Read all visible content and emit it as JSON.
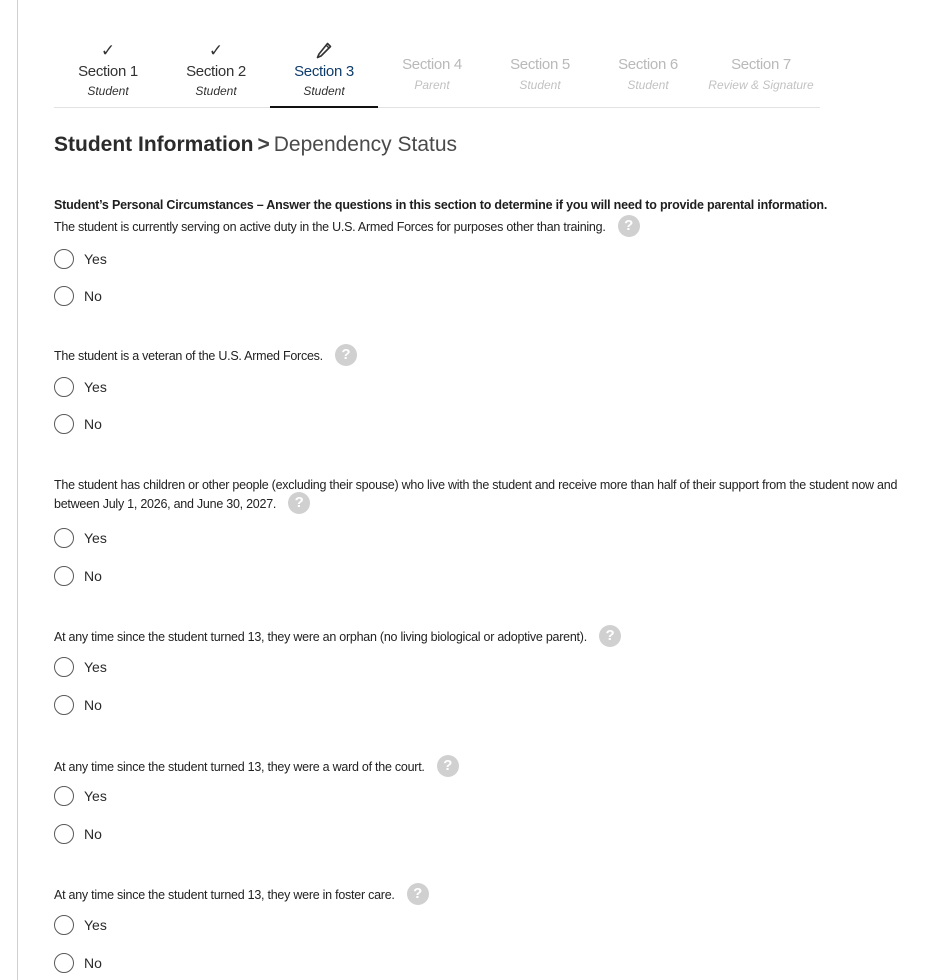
{
  "stepper": [
    {
      "title": "Section 1",
      "subtitle": "Student",
      "status": "complete",
      "icon": "check-icon"
    },
    {
      "title": "Section 2",
      "subtitle": "Student",
      "status": "complete",
      "icon": "check-icon"
    },
    {
      "title": "Section 3",
      "subtitle": "Student",
      "status": "current",
      "icon": "pencil-icon"
    },
    {
      "title": "Section 4",
      "subtitle": "Parent",
      "status": "pending"
    },
    {
      "title": "Section 5",
      "subtitle": "Student",
      "status": "pending"
    },
    {
      "title": "Section 6",
      "subtitle": "Student",
      "status": "pending"
    },
    {
      "title": "Section 7",
      "subtitle": "Review & Signature",
      "status": "pending"
    }
  ],
  "icons": {
    "check": "✓",
    "help": "?"
  },
  "heading": {
    "section": "Student Information",
    "separator": ">",
    "page": "Dependency Status"
  },
  "intro": "Student’s Personal Circumstances – Answer the questions in this section to determine if you will need to provide parental information.",
  "options": {
    "yes": "Yes",
    "no": "No"
  },
  "questions": [
    {
      "text": "The student is currently serving on active duty in the U.S. Armed Forces for purposes other than training."
    },
    {
      "text": "The student is a veteran of the U.S. Armed Forces."
    },
    {
      "text": "The student has children or other people (excluding their spouse) who live with the student and receive more than half of their support from the student now and between July 1, 2026, and June 30, 2027."
    },
    {
      "text": "At any time since the student turned 13, they were an orphan (no living biological or adoptive parent)."
    },
    {
      "text": "At any time since the student turned 13, they were a ward of the court."
    },
    {
      "text": "At any time since the student turned 13, they were in foster care."
    }
  ],
  "colors": {
    "current_step": "#0f3d6b",
    "pending_step": "#b9b9b9",
    "help_icon": "#d0d0d0"
  }
}
